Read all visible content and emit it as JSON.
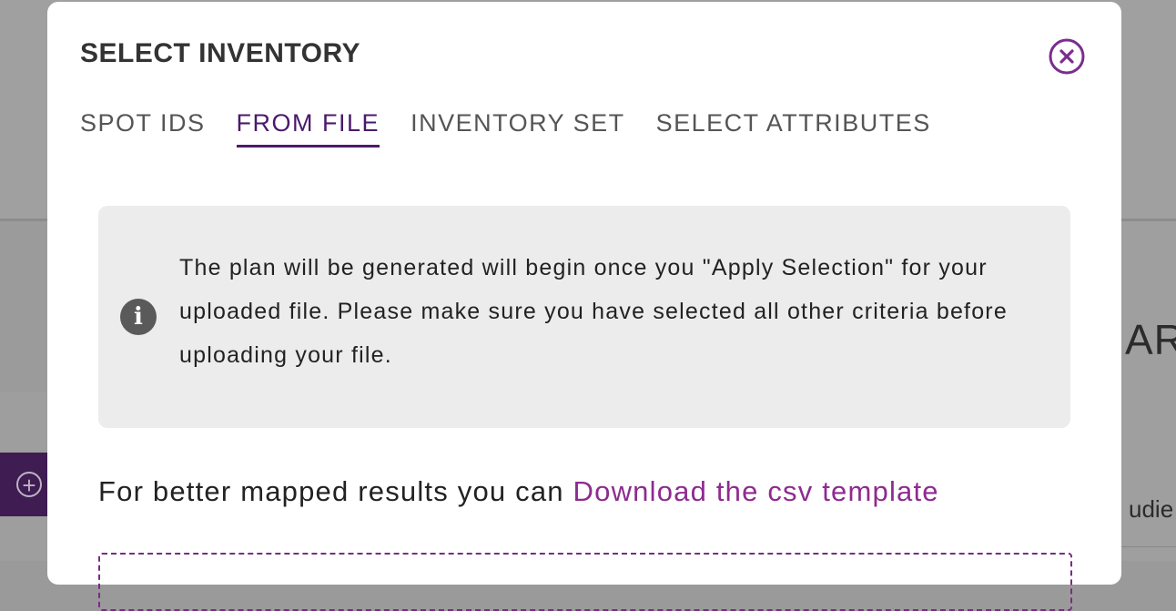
{
  "background": {
    "heading_fragment": "ARY",
    "text_fragment": "udie"
  },
  "modal": {
    "title": "SELECT INVENTORY",
    "close_icon": "close-circle-icon",
    "tabs": [
      {
        "label": "SPOT IDS",
        "active": false
      },
      {
        "label": "FROM FILE",
        "active": true
      },
      {
        "label": "INVENTORY SET",
        "active": false
      },
      {
        "label": "SELECT ATTRIBUTES",
        "active": false
      }
    ],
    "info": {
      "icon": "info-icon",
      "text": "The plan will be generated will begin once you \"Apply Selection\" for your uploaded file. Please make sure you have selected all other criteria before uploading your file."
    },
    "template": {
      "prefix": "For better mapped results you can ",
      "link_label": "Download the csv template"
    }
  },
  "colors": {
    "accent": "#4b1a6b",
    "link": "#8e2b8f",
    "close_icon": "#7b2d8e",
    "info_bg": "#ececec"
  }
}
